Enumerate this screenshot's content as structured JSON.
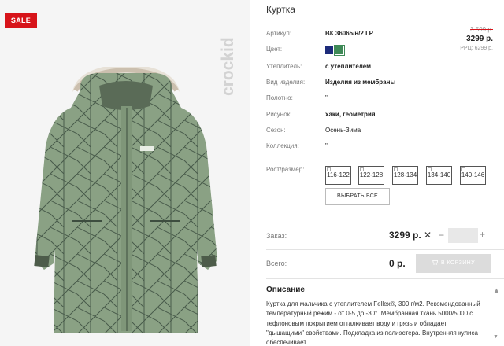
{
  "badge": {
    "sale": "SALE"
  },
  "brand": {
    "name": "crockid"
  },
  "product": {
    "title": "Куртка",
    "price": {
      "old": "3 599 р.",
      "new": "3299 р.",
      "rrp": "РРЦ: 6299 р."
    },
    "colors": {
      "accent_sale": "#d7141a",
      "swatches": [
        "#1d2b7a",
        "#3f8a57"
      ]
    },
    "attributes": [
      {
        "label": "Артикул:",
        "value": "ВК 36065/н/2 ГР"
      },
      {
        "label": "Цвет:",
        "value": ""
      },
      {
        "label": "Утеплитель:",
        "value": "с утеплителем"
      },
      {
        "label": "Вид изделия:",
        "value": "Изделия из мембраны"
      },
      {
        "label": "Полотно:",
        "value": "\""
      },
      {
        "label": "Рисунок:",
        "value": "хаки, геометрия"
      },
      {
        "label": "Сезон:",
        "value": "Осень-Зима"
      },
      {
        "label": "Коллекция:",
        "value": "\""
      },
      {
        "label": "Рост/размер:",
        "value": ""
      }
    ],
    "sizes": [
      "116-122",
      "122-128",
      "128-134",
      "134-140",
      "140-146"
    ],
    "choose_all": "ВЫБРАТЬ ВСЕ"
  },
  "order": {
    "label": "Заказ:",
    "price": "3299 р.",
    "remove": "✕",
    "minus": "−",
    "plus": "+",
    "qty": ""
  },
  "total": {
    "label": "Всего:",
    "value": "0 р.",
    "cart_button": "В КОРЗИНУ"
  },
  "description": {
    "header": "Описание",
    "text": "Куртка для мальчика с утеплителем Fellex®, 300 г/м2. Рекомендованный температурный режим - от 0-5 до -30°. Мембранная ткань 5000/5000 с тефлоновым покрытием отталкивает воду и грязь и обладает \"дышащими\" свойствами. Подкладка из полиэстера. Внутренняя кулиса обеспечивает"
  }
}
